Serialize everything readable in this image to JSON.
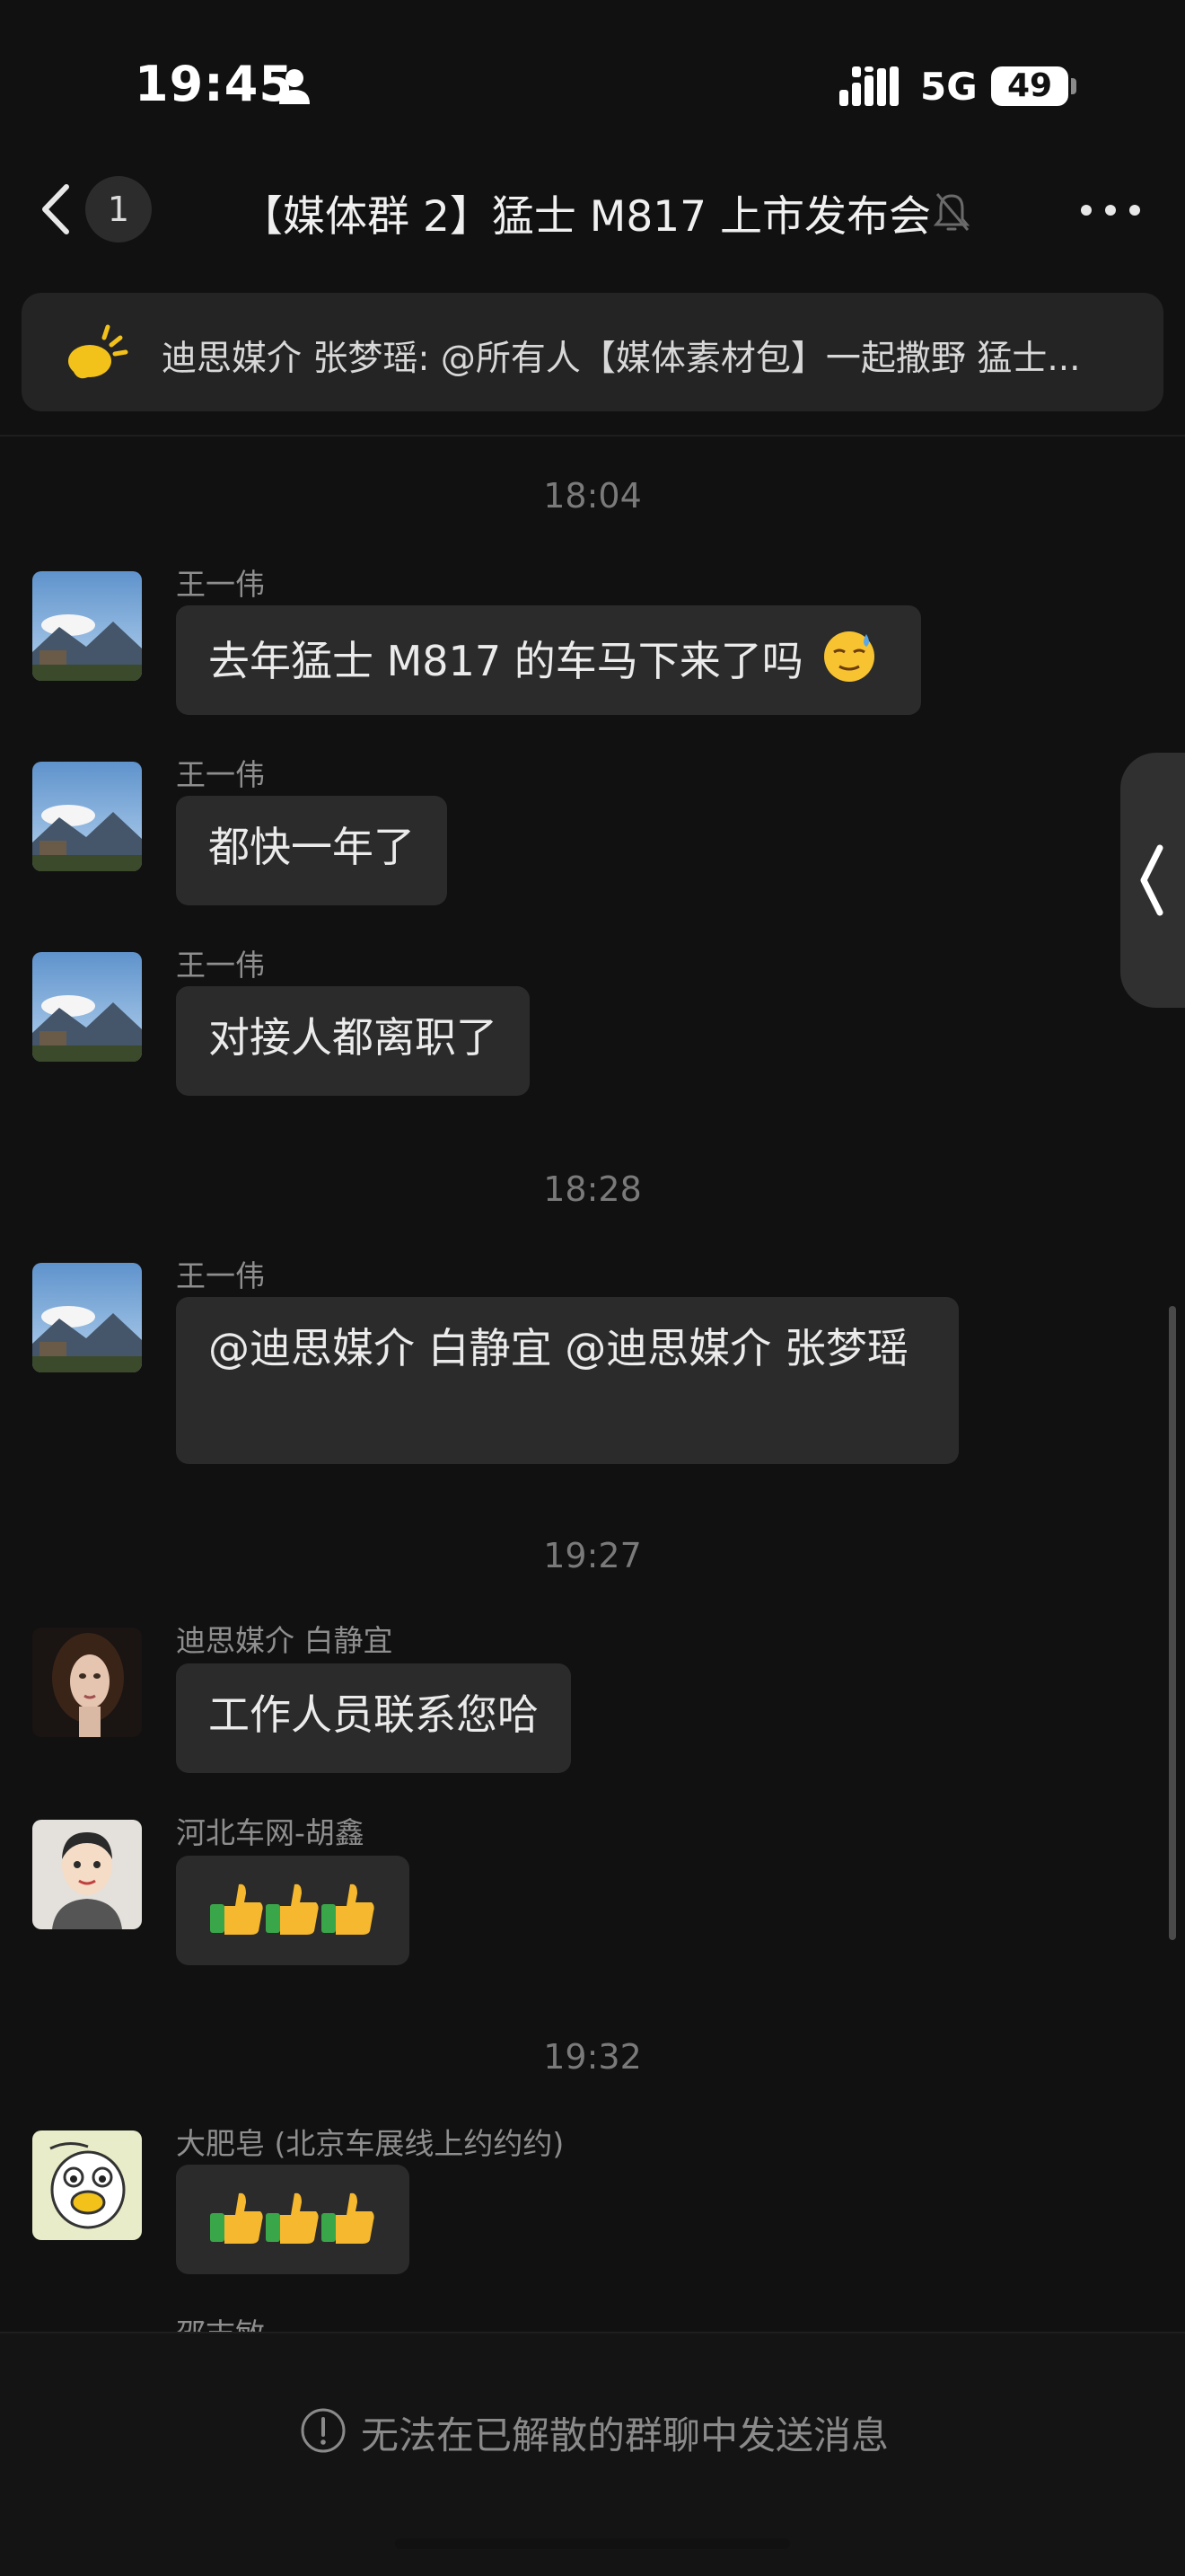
{
  "status_bar": {
    "time": "19:45",
    "network": "5G",
    "battery": "49"
  },
  "header": {
    "unread_count": "1",
    "title": "【媒体群 2】猛士 M817 上市发布会"
  },
  "announcement": {
    "text": "迪思媒介 张梦瑶: @所有人【媒体素材包】一起撒野 猛士..."
  },
  "messages": [
    {
      "time": "18:04"
    },
    {
      "sender": "王一伟",
      "text": "去年猛士 M817 的车马下来了吗",
      "emoji": "sweat-smile"
    },
    {
      "sender": "王一伟",
      "text": "都快一年了"
    },
    {
      "sender": "王一伟",
      "text": "对接人都离职了"
    },
    {
      "time": "18:28"
    },
    {
      "sender": "王一伟",
      "text": "@迪思媒介 白静宜 @迪思媒介 张梦瑶"
    },
    {
      "time": "19:27"
    },
    {
      "sender": "迪思媒介 白静宜",
      "text": "工作人员联系您哈"
    },
    {
      "sender": "河北车网-胡鑫",
      "emoji": "thumbs-up x3"
    },
    {
      "time": "19:32"
    },
    {
      "sender": "大肥皂 (北京车展线上约约约)",
      "emoji": "thumbs-up x3"
    },
    {
      "sender": "邵志敏"
    }
  ],
  "footer": {
    "notice": "无法在已解散的群聊中发送消息"
  },
  "colors": {
    "background": "#111111",
    "bubble": "#2b2b2b",
    "announcement_icon": "#f2c21b",
    "thumb": "#f5b82e",
    "cuff": "#3aa64a"
  }
}
